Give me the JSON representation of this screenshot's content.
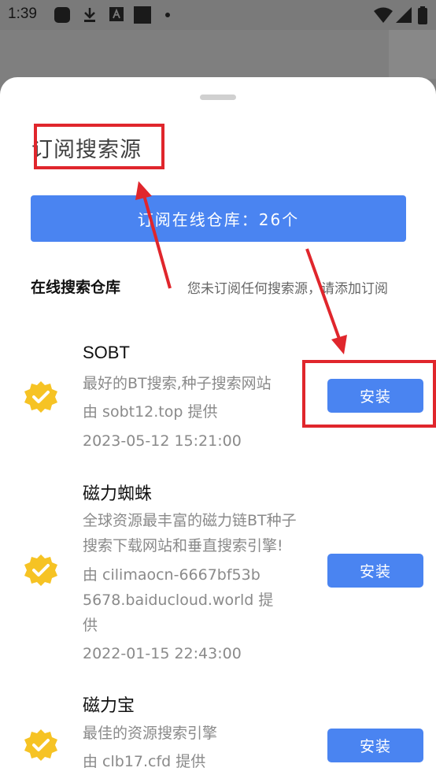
{
  "status_bar": {
    "time": "1:39",
    "left_icons": [
      "app-icon",
      "download-icon",
      "font-icon",
      "square-icon",
      "dot-icon"
    ],
    "right_icons": [
      "wifi-icon",
      "signal-icon",
      "battery-icon"
    ]
  },
  "sheet": {
    "title": "订阅搜索源",
    "subscribe_button": "订阅在线仓库：26个",
    "section_heading": "在线搜索仓库",
    "section_hint": "您未订阅任何搜索源，请添加订阅"
  },
  "items": [
    {
      "name": "SOBT",
      "description": [
        "最好的BT搜索,种子搜索网站"
      ],
      "provider": [
        "由 sobt12.top 提供"
      ],
      "date": "2023-05-12 15:21:00",
      "button": "安装"
    },
    {
      "name": "磁力蜘蛛",
      "description": [
        "全球资源最丰富的磁力链BT种子",
        "搜索下载网站和垂直搜索引擎!"
      ],
      "provider": [
        "由 cilimaocn-6667bf53b",
        "5678.baiducloud.world 提",
        "供"
      ],
      "date": "2022-01-15 22:43:00",
      "button": "安装"
    },
    {
      "name": "磁力宝",
      "description": [
        "最佳的资源搜索引擎"
      ],
      "provider": [
        "由 clb17.cfd 提供"
      ],
      "date": "",
      "button": "安装"
    }
  ],
  "colors": {
    "accent": "#4a84f1",
    "badge": "#f6c324",
    "annotation": "#e0262c"
  }
}
